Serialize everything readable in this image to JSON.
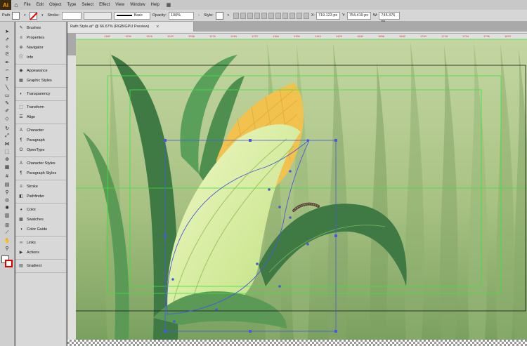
{
  "app": {
    "logo": "Ai",
    "menu": [
      "File",
      "Edit",
      "Object",
      "Type",
      "Select",
      "Effect",
      "View",
      "Window",
      "Help"
    ]
  },
  "control": {
    "selection_label": "Path",
    "stroke_label": "Stroke:",
    "stroke_style": "Basic",
    "opacity_label": "Opacity:",
    "opacity_value": "100%",
    "style_label": "Style:",
    "x_label": "X:",
    "x_value": "719.123 px",
    "y_label": "Y:",
    "y_value": "754.419 px",
    "w_label": "W:",
    "w_value": "745.376 px"
  },
  "document": {
    "tab_title": "Rath Style.ai* @ 66.67% (RGB/GPU Preview)",
    "close_glyph": "×"
  },
  "ruler_ticks": [
    "1382",
    "1290",
    "1316",
    "1242",
    "1258",
    "1276",
    "1284",
    "1370",
    "1384",
    "1390",
    "1410",
    "1426",
    "1530",
    "1656",
    "1682",
    "1700",
    "1718",
    "1734",
    "1796",
    "1870"
  ],
  "panels": [
    {
      "group": [
        {
          "name": "Brushes",
          "icon": "brush-icon",
          "glyph": "✎"
        },
        {
          "name": "Properties",
          "icon": "properties-icon",
          "glyph": "≡"
        },
        {
          "name": "Navigator",
          "icon": "navigator-icon",
          "glyph": "⊕"
        },
        {
          "name": "Info",
          "icon": "info-icon",
          "glyph": "ⓘ"
        }
      ]
    },
    {
      "group": [
        {
          "name": "Appearance",
          "icon": "appearance-icon",
          "glyph": "◉"
        },
        {
          "name": "Graphic Styles",
          "icon": "graphic-styles-icon",
          "glyph": "▦"
        }
      ]
    },
    {
      "group": [
        {
          "name": "Transparency",
          "icon": "transparency-icon",
          "glyph": "◐"
        }
      ]
    },
    {
      "group": [
        {
          "name": "Transform",
          "icon": "transform-icon",
          "glyph": "⬚"
        },
        {
          "name": "Align",
          "icon": "align-icon",
          "glyph": "☰"
        }
      ]
    },
    {
      "group": [
        {
          "name": "Character",
          "icon": "character-icon",
          "glyph": "A"
        },
        {
          "name": "Paragraph",
          "icon": "paragraph-icon",
          "glyph": "¶"
        },
        {
          "name": "OpenType",
          "icon": "opentype-icon",
          "glyph": "O"
        }
      ]
    },
    {
      "group": [
        {
          "name": "Character Styles",
          "icon": "character-styles-icon",
          "glyph": "A"
        },
        {
          "name": "Paragraph Styles",
          "icon": "paragraph-styles-icon",
          "glyph": "¶"
        }
      ]
    },
    {
      "group": [
        {
          "name": "Stroke",
          "icon": "stroke-icon",
          "glyph": "≡"
        },
        {
          "name": "Pathfinder",
          "icon": "pathfinder-icon",
          "glyph": "◧"
        }
      ]
    },
    {
      "group": [
        {
          "name": "Color",
          "icon": "color-icon",
          "glyph": "◕"
        },
        {
          "name": "Swatches",
          "icon": "swatches-icon",
          "glyph": "▩"
        },
        {
          "name": "Color Guide",
          "icon": "color-guide-icon",
          "glyph": "◑"
        }
      ]
    },
    {
      "group": [
        {
          "name": "Links",
          "icon": "links-icon",
          "glyph": "∞"
        },
        {
          "name": "Actions",
          "icon": "actions-icon",
          "glyph": "▶"
        }
      ]
    },
    {
      "group": [
        {
          "name": "Gradient",
          "icon": "gradient-icon",
          "glyph": "▤"
        }
      ]
    }
  ],
  "tools": [
    {
      "name": "selection-tool",
      "glyph": "➤"
    },
    {
      "name": "direct-selection-tool",
      "glyph": "⇗"
    },
    {
      "name": "magic-wand-tool",
      "glyph": "✧"
    },
    {
      "name": "lasso-tool",
      "glyph": "ᘓ"
    },
    {
      "name": "pen-tool",
      "glyph": "✒"
    },
    {
      "name": "curvature-tool",
      "glyph": "∽"
    },
    {
      "name": "type-tool",
      "glyph": "T"
    },
    {
      "name": "line-tool",
      "glyph": "╲"
    },
    {
      "name": "rectangle-tool",
      "glyph": "▭"
    },
    {
      "name": "paintbrush-tool",
      "glyph": "✎"
    },
    {
      "name": "pencil-tool",
      "glyph": "✐"
    },
    {
      "name": "eraser-tool",
      "glyph": "◇"
    },
    {
      "name": "rotate-tool",
      "glyph": "↻"
    },
    {
      "name": "scale-tool",
      "glyph": "⤢"
    },
    {
      "name": "width-tool",
      "glyph": "⋈"
    },
    {
      "name": "free-transform-tool",
      "glyph": "⬚"
    },
    {
      "name": "shape-builder-tool",
      "glyph": "⊕"
    },
    {
      "name": "perspective-grid-tool",
      "glyph": "▦"
    },
    {
      "name": "mesh-tool",
      "glyph": "#"
    },
    {
      "name": "gradient-tool",
      "glyph": "▤"
    },
    {
      "name": "eyedropper-tool",
      "glyph": "⚲"
    },
    {
      "name": "blend-tool",
      "glyph": "◎"
    },
    {
      "name": "symbol-sprayer-tool",
      "glyph": "✺"
    },
    {
      "name": "column-graph-tool",
      "glyph": "▥"
    },
    {
      "name": "artboard-tool",
      "glyph": "⊞"
    },
    {
      "name": "slice-tool",
      "glyph": "⟋"
    },
    {
      "name": "hand-tool",
      "glyph": "✋"
    },
    {
      "name": "zoom-tool",
      "glyph": "⚲"
    }
  ],
  "colors": {
    "bg_light": "#b9cc96",
    "bg_mid": "#9fb87c",
    "bg_dark": "#7a9a5e",
    "leaf_dark": "#3f7a45",
    "leaf_mid": "#5a9a56",
    "husk": "#dff0a8",
    "kernel": "#f2c24e",
    "guide": "#39e639",
    "path": "#4a5ad8"
  }
}
